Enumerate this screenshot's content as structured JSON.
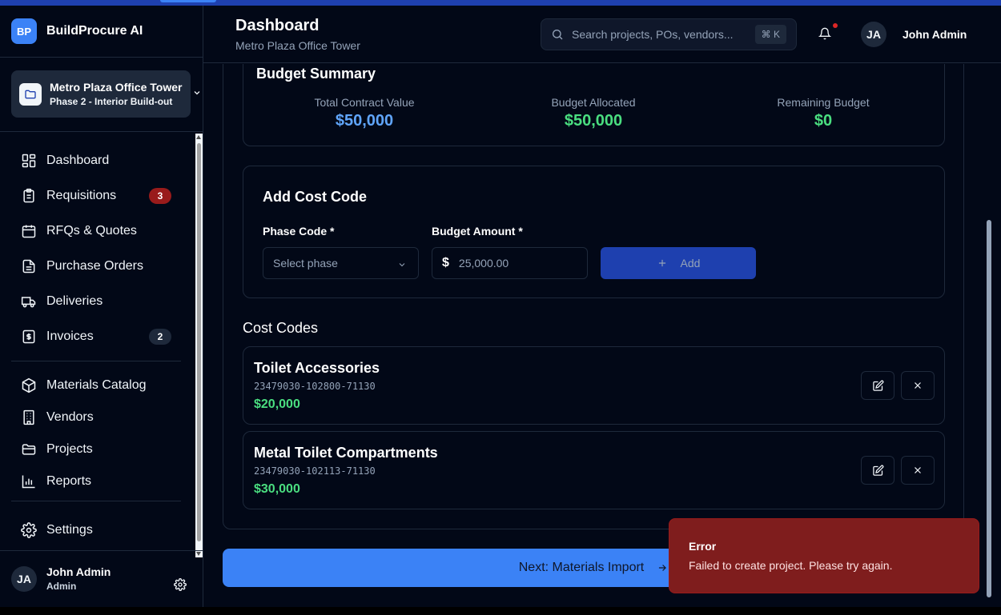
{
  "brand": {
    "logo": "BP",
    "name": "BuildProcure AI"
  },
  "project_switcher": {
    "name": "Metro Plaza Office Tower",
    "phase": "Phase 2 - Interior Build-out"
  },
  "nav": {
    "items": [
      {
        "label": "Dashboard",
        "icon": "grid-icon"
      },
      {
        "label": "Requisitions",
        "icon": "clipboard-icon",
        "badge": "3"
      },
      {
        "label": "RFQs & Quotes",
        "icon": "calendar-icon"
      },
      {
        "label": "Purchase Orders",
        "icon": "file-icon"
      },
      {
        "label": "Deliveries",
        "icon": "truck-icon"
      },
      {
        "label": "Invoices",
        "icon": "dollar-file-icon",
        "badge": "2"
      },
      {
        "label": "Materials Catalog",
        "icon": "box-icon"
      },
      {
        "label": "Vendors",
        "icon": "building-icon"
      },
      {
        "label": "Projects",
        "icon": "folder-icon"
      },
      {
        "label": "Reports",
        "icon": "bar-chart-icon"
      },
      {
        "label": "Settings",
        "icon": "gear-icon"
      }
    ]
  },
  "sidebar_user": {
    "initials": "JA",
    "name": "John Admin",
    "role": "Admin"
  },
  "header": {
    "title": "Dashboard",
    "subtitle": "Metro Plaza Office Tower",
    "search_placeholder": "Search projects, POs, vendors...",
    "shortcut": "⌘ K",
    "user_initials": "JA",
    "user_name": "John Admin"
  },
  "budget_summary": {
    "title": "Budget Summary",
    "items": [
      {
        "label": "Total Contract Value",
        "value": "$50,000",
        "color": "#60a5fa"
      },
      {
        "label": "Budget Allocated",
        "value": "$50,000",
        "color": "#4ade80"
      },
      {
        "label": "Remaining Budget",
        "value": "$0",
        "color": "#4ade80"
      }
    ]
  },
  "add_cost_code": {
    "title": "Add Cost Code",
    "phase_label": "Phase Code *",
    "phase_placeholder": "Select phase",
    "amount_label": "Budget Amount *",
    "currency": "$",
    "amount_placeholder": "25,000.00",
    "add_label": "Add"
  },
  "cost_codes": {
    "title": "Cost Codes",
    "items": [
      {
        "name": "Toilet Accessories",
        "code": "23479030-102800-71130",
        "amount": "$20,000"
      },
      {
        "name": "Metal Toilet Compartments",
        "code": "23479030-102113-71130",
        "amount": "$30,000"
      }
    ]
  },
  "next_button": {
    "label": "Next: Materials Import"
  },
  "toast": {
    "title": "Error",
    "message": "Failed to create project. Please try again."
  },
  "colors": {
    "accent": "#3b82f6",
    "success": "#4ade80",
    "danger": "#7f1d1d",
    "background": "#020817"
  }
}
